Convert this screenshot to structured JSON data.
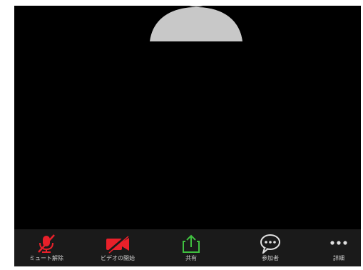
{
  "toolbar": {
    "unmute_label": "ミュート解除",
    "start_video_label": "ビデオの開始",
    "share_label": "共有",
    "participants_label": "参加者",
    "more_label": "詳細"
  },
  "icons": {
    "unmute": "muted-microphone-icon",
    "video": "video-off-icon",
    "share": "share-upload-icon",
    "participants": "chat-bubble-icon",
    "more": "more-dots-icon"
  },
  "colors": {
    "muted_red": "#e8202a",
    "share_green": "#3fbf3f",
    "avatar_gray": "#c8c8c8"
  }
}
